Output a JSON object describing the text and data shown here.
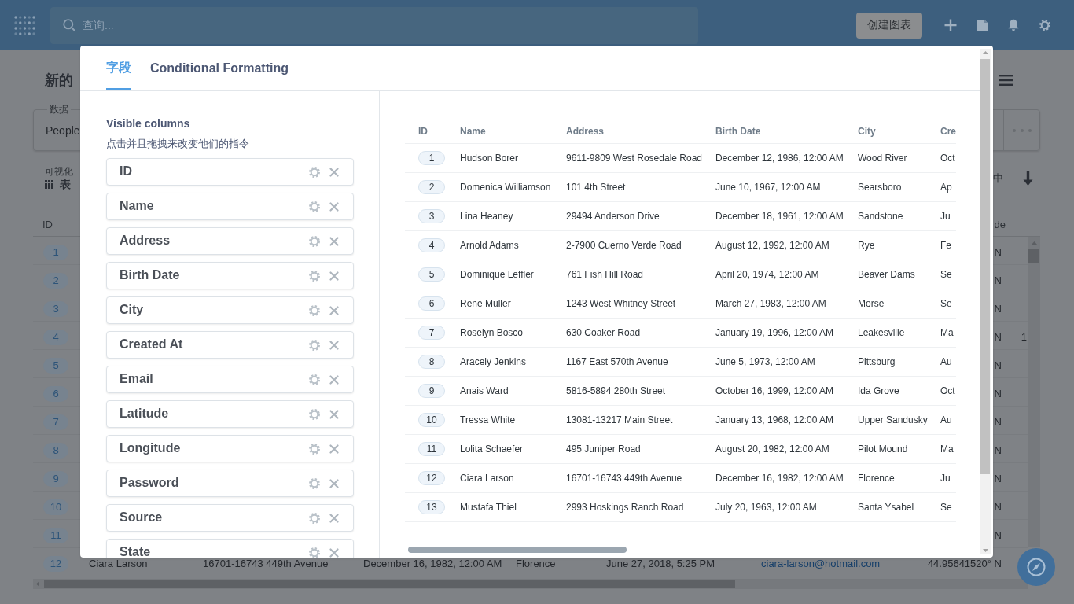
{
  "top_bar": {
    "search": {
      "placeholder": "查询..."
    },
    "new_question_button": "创建图表"
  },
  "page": {
    "title": "新的",
    "data": {
      "label": "数据",
      "source": "People"
    },
    "visualization": {
      "label": "可视化",
      "type": "表"
    },
    "display_label": "中"
  },
  "results_table": {
    "header": {
      "id": "ID",
      "latitude": "de"
    },
    "rows": [
      {
        "id": "1",
        "latitude": "N"
      },
      {
        "id": "2",
        "latitude": "N"
      },
      {
        "id": "3",
        "latitude": "N"
      },
      {
        "id": "4",
        "latitude": "N",
        "column_9": "1"
      },
      {
        "id": "5",
        "latitude": "N"
      },
      {
        "id": "6",
        "latitude": "N"
      },
      {
        "id": "7",
        "latitude": "N"
      },
      {
        "id": "8",
        "latitude": "N"
      },
      {
        "id": "9",
        "latitude": "N"
      },
      {
        "id": "10",
        "latitude": "N"
      },
      {
        "id": "11",
        "latitude": "N"
      },
      {
        "id": "12",
        "name": "Ciara Larson",
        "address": "16701-16743 449th Avenue",
        "birth_date": "December 16, 1982, 12:00 AM",
        "city": "Florence",
        "created_at": "June 27, 2018, 5:25 PM",
        "email": "ciara-larson@hotmail.com",
        "latitude": "44.95641520° N"
      }
    ]
  },
  "modal": {
    "tabs": [
      {
        "label": "字段",
        "selected": true
      },
      {
        "label": "Conditional Formatting",
        "selected": false
      }
    ],
    "columns_panel": {
      "title": "Visible columns",
      "hint": "点击并且拖拽来改变他们的指令",
      "items": [
        "ID",
        "Name",
        "Address",
        "Birth Date",
        "City",
        "Created At",
        "Email",
        "Latitude",
        "Longitude",
        "Password",
        "Source",
        "State"
      ]
    },
    "preview_table": {
      "columns": [
        "ID",
        "Name",
        "Address",
        "Birth Date",
        "City",
        "Cre"
      ],
      "rows": [
        [
          "1",
          "Hudson Borer",
          "9611-9809 West Rosedale Road",
          "December 12, 1986, 12:00 AM",
          "Wood River",
          "Oct"
        ],
        [
          "2",
          "Domenica Williamson",
          "101 4th Street",
          "June 10, 1967, 12:00 AM",
          "Searsboro",
          "Ap"
        ],
        [
          "3",
          "Lina Heaney",
          "29494 Anderson Drive",
          "December 18, 1961, 12:00 AM",
          "Sandstone",
          "Ju"
        ],
        [
          "4",
          "Arnold Adams",
          "2-7900 Cuerno Verde Road",
          "August 12, 1992, 12:00 AM",
          "Rye",
          "Fe"
        ],
        [
          "5",
          "Dominique Leffler",
          "761 Fish Hill Road",
          "April 20, 1974, 12:00 AM",
          "Beaver Dams",
          "Se"
        ],
        [
          "6",
          "Rene Muller",
          "1243 West Whitney Street",
          "March 27, 1983, 12:00 AM",
          "Morse",
          "Se"
        ],
        [
          "7",
          "Roselyn Bosco",
          "630 Coaker Road",
          "January 19, 1996, 12:00 AM",
          "Leakesville",
          "Ma"
        ],
        [
          "8",
          "Aracely Jenkins",
          "1167 East 570th Avenue",
          "June 5, 1973, 12:00 AM",
          "Pittsburg",
          "Au"
        ],
        [
          "9",
          "Anais Ward",
          "5816-5894 280th Street",
          "October 16, 1999, 12:00 AM",
          "Ida Grove",
          "Oct"
        ],
        [
          "10",
          "Tressa White",
          "13081-13217 Main Street",
          "January 13, 1968, 12:00 AM",
          "Upper Sandusky",
          "Au"
        ],
        [
          "11",
          "Lolita Schaefer",
          "495 Juniper Road",
          "August 20, 1982, 12:00 AM",
          "Pilot Mound",
          "Ma"
        ],
        [
          "12",
          "Ciara Larson",
          "16701-16743 449th Avenue",
          "December 16, 1982, 12:00 AM",
          "Florence",
          "Ju"
        ],
        [
          "13",
          "Mustafa Thiel",
          "2993 Hoskings Ranch Road",
          "July 20, 1963, 12:00 AM",
          "Santa Ysabel",
          "Se"
        ]
      ]
    }
  }
}
